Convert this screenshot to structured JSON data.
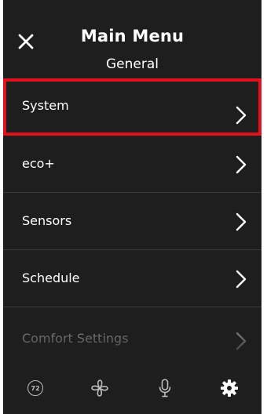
{
  "header": {
    "title": "Main Menu",
    "subtitle": "General"
  },
  "menu": {
    "items": [
      {
        "label": "System",
        "highlighted": true
      },
      {
        "label": "eco+"
      },
      {
        "label": "Sensors"
      },
      {
        "label": "Schedule"
      },
      {
        "label": "Comfort Settings"
      }
    ]
  },
  "bottom_bar": {
    "temperature": "72",
    "icons": [
      "thermostat-temp-icon",
      "fan-icon",
      "microphone-icon",
      "gear-icon"
    ],
    "active_icon": "gear-icon"
  },
  "colors": {
    "background": "#1e1e1e",
    "text": "#ffffff",
    "highlight_border": "#e3111e",
    "divider": "#3a3a3a",
    "inactive_icon": "#bdbdbd"
  }
}
